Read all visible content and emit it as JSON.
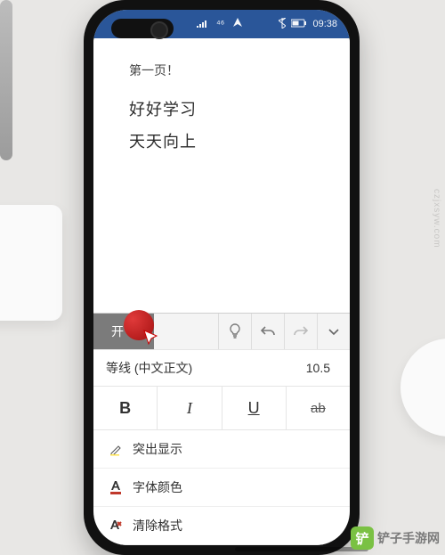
{
  "status": {
    "net": "⁴⁶",
    "time": "09:38"
  },
  "document": {
    "page_label": "第一页！",
    "line1": "好好学习",
    "line2": "天天向上"
  },
  "ribbon": {
    "start_label": "开"
  },
  "font": {
    "name": "等线 (中文正文)",
    "size": "10.5"
  },
  "style": {
    "bold": "B",
    "italic": "I",
    "underline": "U",
    "strike": "ab"
  },
  "options": {
    "highlight": "突出显示",
    "font_color": "字体颜色",
    "clear_format": "清除格式"
  },
  "watermark": {
    "side": "czjxsyw.com",
    "brand": "铲子手游网"
  }
}
